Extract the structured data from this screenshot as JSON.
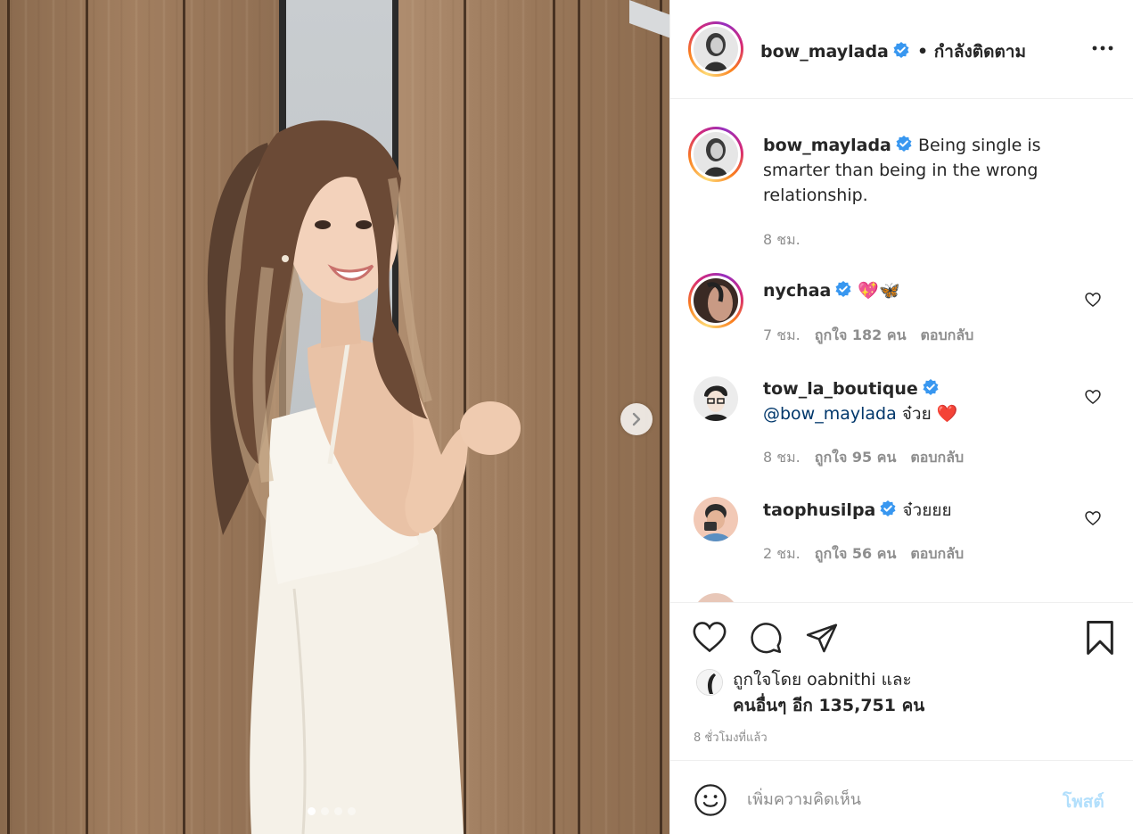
{
  "post": {
    "author": "bow_maylada",
    "follow_status": "• กำลังติดตาม",
    "caption": "Being single is smarter than being in the wrong relationship.",
    "caption_time": "8 ชม.",
    "carousel": {
      "count": 4,
      "active": 0
    }
  },
  "comments": [
    {
      "username": "nychaa",
      "verified": true,
      "text": "💖🦋",
      "time": "7 ชม.",
      "likes": "ถูกใจ 182 คน",
      "reply": "ตอบกลับ"
    },
    {
      "username": "tow_la_boutique",
      "verified": true,
      "mention": "@bow_maylada",
      "text": "จ๋วย ❤️",
      "time": "8 ชม.",
      "likes": "ถูกใจ 95 คน",
      "reply": "ตอบกลับ"
    },
    {
      "username": "taophusilpa",
      "verified": true,
      "text": "จ๋วยยย",
      "time": "2 ชม.",
      "likes": "ถูกใจ 56 คน",
      "reply": "ตอบกลับ"
    }
  ],
  "likes_summary": {
    "line1_prefix": "ถูกใจโดย",
    "line1_user": "oabnithi",
    "line1_suffix": "และ",
    "line2": "คนอื่นๆ อีก 135,751 คน"
  },
  "posted_time": "8 ชั่วโมงที่แล้ว",
  "add_comment": {
    "placeholder": "เพิ่มความคิดเห็น",
    "post_label": "โพสต์"
  },
  "colors": {
    "verified": "#3897f0",
    "link_disabled": "#b2dffc",
    "meta_gray": "#8e8e8e",
    "border": "#efefef",
    "mention": "#00376b"
  },
  "icons": [
    "chevron-right-icon",
    "more-options-icon",
    "verified-badge-icon",
    "heart-icon",
    "comment-icon",
    "share-icon",
    "bookmark-icon",
    "emoji-icon"
  ]
}
